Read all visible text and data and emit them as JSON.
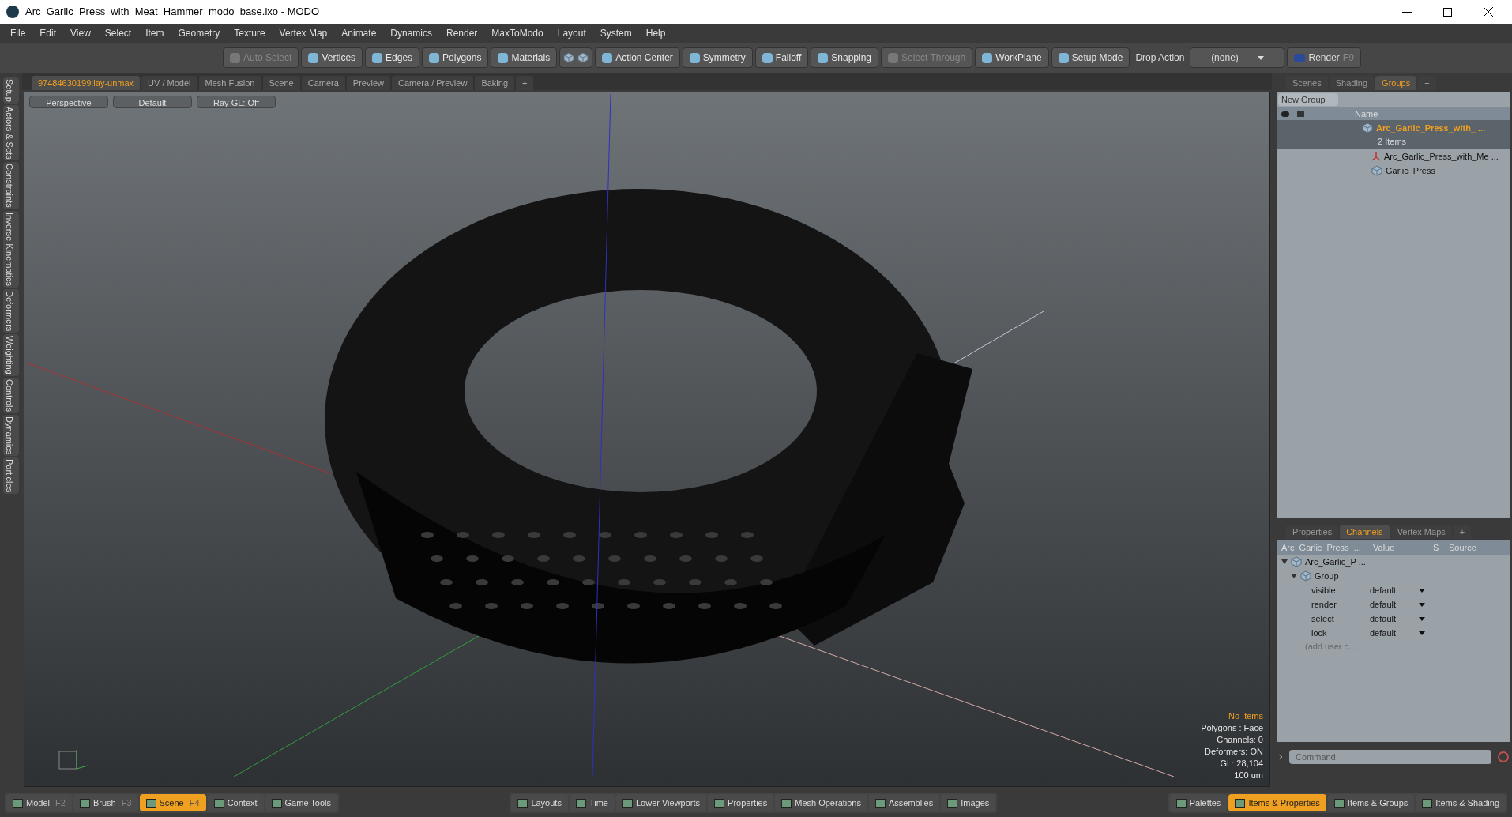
{
  "window": {
    "title": "Arc_Garlic_Press_with_Meat_Hammer_modo_base.lxo - MODO"
  },
  "menu": [
    "File",
    "Edit",
    "View",
    "Select",
    "Item",
    "Geometry",
    "Texture",
    "Vertex Map",
    "Animate",
    "Dynamics",
    "Render",
    "MaxToModo",
    "Layout",
    "System",
    "Help"
  ],
  "toolbar": [
    {
      "label": "Auto Select",
      "disabled": true
    },
    {
      "label": "Vertices",
      "disabled": false
    },
    {
      "label": "Edges",
      "disabled": false
    },
    {
      "label": "Polygons",
      "disabled": false
    },
    {
      "label": "Materials",
      "disabled": false
    },
    {
      "label": "Action Center",
      "disabled": false
    },
    {
      "label": "Symmetry",
      "disabled": false
    },
    {
      "label": "Falloff",
      "disabled": false
    },
    {
      "label": "Snapping",
      "disabled": false
    },
    {
      "label": "Select Through",
      "disabled": true
    },
    {
      "label": "WorkPlane",
      "disabled": false
    },
    {
      "label": "Setup Mode",
      "disabled": false
    }
  ],
  "drop_action": {
    "label": "Drop Action",
    "value": "(none)"
  },
  "render": {
    "label": "Render",
    "shortcut": "F9"
  },
  "viewport_tabs": [
    {
      "label": "97484630199:lay-unmax",
      "selected": true
    },
    {
      "label": "UV / Model",
      "selected": false
    },
    {
      "label": "Mesh Fusion",
      "selected": false
    },
    {
      "label": "Scene",
      "selected": false
    },
    {
      "label": "Camera",
      "selected": false
    },
    {
      "label": "Preview",
      "selected": false
    },
    {
      "label": "Camera / Preview",
      "selected": false
    },
    {
      "label": "Baking",
      "selected": false
    },
    {
      "label": "+",
      "selected": false
    }
  ],
  "side_tabs": [
    "Setup",
    "Actors & Sets",
    "Constraints",
    "Inverse Kinematics",
    "Deformers",
    "Weighting",
    "Controls",
    "Dynamics",
    "Particles"
  ],
  "viewport": {
    "buttons": [
      "Perspective",
      "Default",
      "Ray GL: Off"
    ],
    "info_title": "No Items",
    "info": [
      "Polygons : Face",
      "Channels: 0",
      "Deformers: ON",
      "GL: 28,104",
      "100 um"
    ]
  },
  "groups_panel": {
    "tabs": [
      {
        "label": "Scenes",
        "selected": false
      },
      {
        "label": "Shading",
        "selected": false
      },
      {
        "label": "Groups",
        "selected": true
      },
      {
        "label": "+",
        "selected": false
      }
    ],
    "new_group": "New Group",
    "name_header": "Name",
    "group": {
      "name": "Arc_Garlic_Press_with_  ...",
      "count": "2 Items",
      "selected": true,
      "children": [
        {
          "kind": "locator",
          "name": "Arc_Garlic_Press_with_Me  ..."
        },
        {
          "kind": "mesh",
          "name": "Garlic_Press"
        }
      ]
    }
  },
  "channels_panel": {
    "tabs": [
      {
        "label": "Properties",
        "selected": false
      },
      {
        "label": "Channels",
        "selected": true
      },
      {
        "label": "Vertex Maps",
        "selected": false
      },
      {
        "label": "+",
        "selected": false
      }
    ],
    "columns": [
      "Arc_Garlic_Press_...",
      "Value",
      "S",
      "Source"
    ],
    "tree": {
      "name": "Arc_Garlic_P ...",
      "expanded": true,
      "children": [
        {
          "name": "Group",
          "expanded": true,
          "channels": [
            {
              "name": "visible",
              "value": "default"
            },
            {
              "name": "render",
              "value": "default"
            },
            {
              "name": "select",
              "value": "default"
            },
            {
              "name": "lock",
              "value": "default"
            }
          ],
          "add": "(add user c..."
        }
      ]
    },
    "command_placeholder": "Command"
  },
  "bottom_bar": [
    [
      {
        "label": "Model",
        "shortcut": "F2",
        "selected": false
      },
      {
        "label": "Brush",
        "shortcut": "F3",
        "selected": false
      },
      {
        "label": "Scene",
        "shortcut": "F4",
        "selected": true
      },
      {
        "label": "Context",
        "selected": false
      },
      {
        "label": "Game Tools",
        "selected": false
      }
    ],
    [
      {
        "label": "Layouts",
        "selected": false
      },
      {
        "label": "Time",
        "selected": false
      },
      {
        "label": "Lower Viewports",
        "selected": false
      },
      {
        "label": "Properties",
        "selected": false
      },
      {
        "label": "Mesh Operations",
        "selected": false
      },
      {
        "label": "Assemblies",
        "selected": false
      },
      {
        "label": "Images",
        "selected": false
      }
    ],
    [
      {
        "label": "Palettes",
        "selected": false
      },
      {
        "label": "Items & Properties",
        "selected": true
      },
      {
        "label": "Items & Groups",
        "selected": false
      },
      {
        "label": "Items & Shading",
        "selected": false
      }
    ]
  ]
}
